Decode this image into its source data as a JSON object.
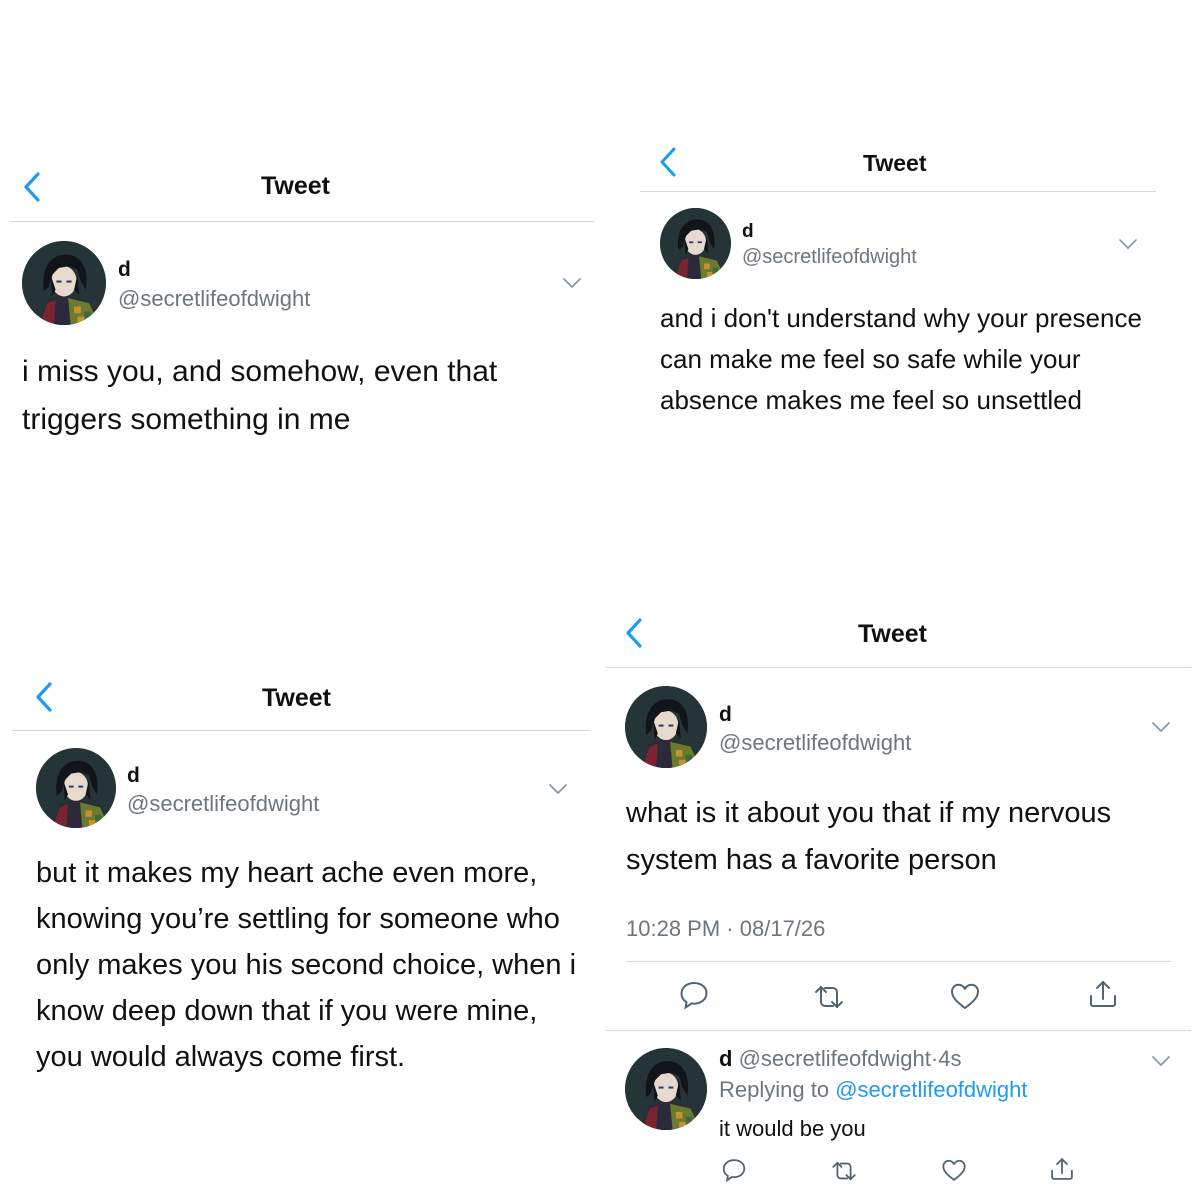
{
  "colors": {
    "accent": "#1d9bf0",
    "secondary_text": "#6e767d",
    "divider": "#d7d7d7"
  },
  "header_title": "Tweet",
  "author": {
    "name": "d",
    "handle": "@secretlifeofdwight"
  },
  "tweets": [
    {
      "text": "i miss you, and somehow, even that triggers something in me"
    },
    {
      "text": "and i don't understand why your presence can make me feel so safe while your absence makes me feel so unsettled"
    },
    {
      "text": "but it makes my heart ache even more, knowing you’re settling for someone who only makes you his second choice, when i know deep down that if you were mine, you would always come first."
    },
    {
      "text": "what is it about you that if my nervous system has a favorite person",
      "time": "10:28 PM",
      "separator": "·",
      "date": "08/17/26"
    }
  ],
  "reply": {
    "name": "d",
    "handle": "@secretlifeofdwight",
    "separator": "·",
    "age": "4s",
    "replying_label": "Replying to",
    "replying_to": "@secretlifeofdwight",
    "text": "it would be you"
  },
  "icons": {
    "back": "chevron-left-icon",
    "more": "chevron-down-icon",
    "reply": "speech-bubble-icon",
    "retweet": "retweet-icon",
    "like": "heart-icon",
    "share": "share-icon"
  }
}
